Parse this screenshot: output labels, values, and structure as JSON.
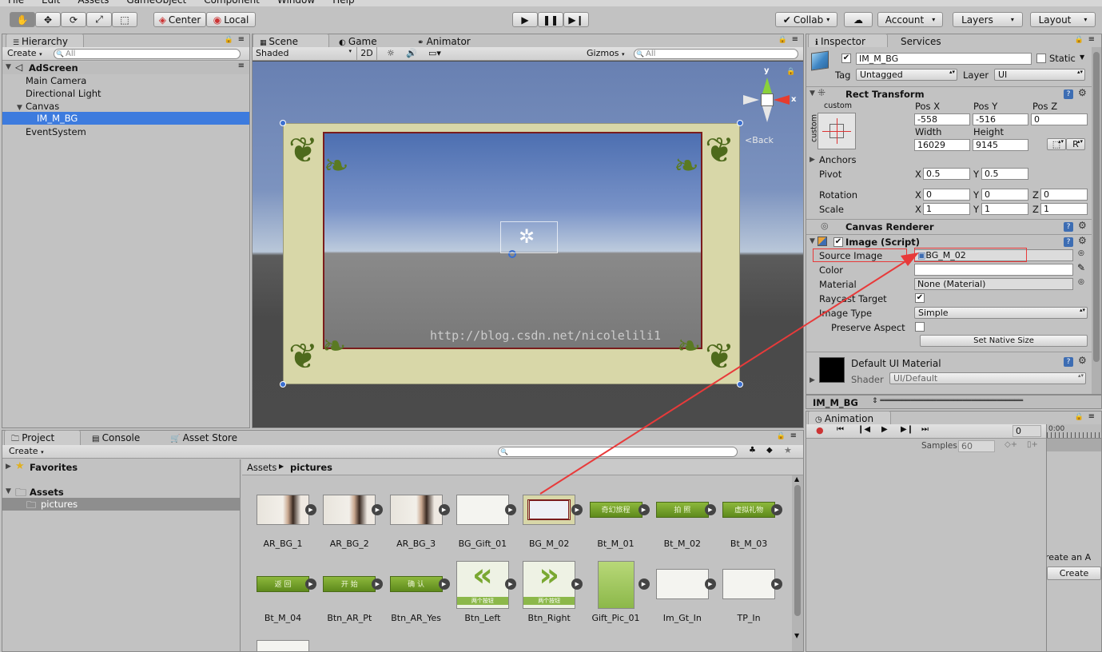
{
  "menubar": {
    "items": [
      "File",
      "Edit",
      "Assets",
      "GameObject",
      "Component",
      "Window",
      "Help"
    ]
  },
  "toolbar": {
    "tools": [
      "hand-icon",
      "move-icon",
      "rotate-icon",
      "scale-icon",
      "rect-icon"
    ],
    "pivot_center": "Center",
    "pivot_local": "Local",
    "collab": "Collab",
    "account": "Account",
    "layers": "Layers",
    "layout": "Layout"
  },
  "hierarchy": {
    "tab": "Hierarchy",
    "create": "Create",
    "search_placeholder": "All",
    "scene": "AdScreen",
    "items": [
      {
        "label": "Main Camera"
      },
      {
        "label": "Directional Light"
      },
      {
        "label": "Canvas"
      },
      {
        "label": "IM_M_BG"
      },
      {
        "label": "EventSystem"
      }
    ]
  },
  "scene_view": {
    "tabs": [
      "Scene",
      "Game",
      "Animator"
    ],
    "shading": "Shaded",
    "mode_2d": "2D",
    "gizmos": "Gizmos",
    "search_placeholder": "All",
    "back_label": "Back",
    "gizmo_y": "y",
    "gizmo_x": "x",
    "watermark": "http://blog.csdn.net/nicolelili1"
  },
  "inspector": {
    "tabs": [
      "Inspector",
      "Services"
    ],
    "object_name": "IM_M_BG",
    "static_label": "Static",
    "tag_label": "Tag",
    "tag_value": "Untagged",
    "layer_label": "Layer",
    "layer_value": "UI",
    "rect_transform": {
      "title": "Rect Transform",
      "anchor_preset": "custom",
      "anchor_side": "custom",
      "pos_x_label": "Pos X",
      "pos_x": "-558",
      "pos_y_label": "Pos Y",
      "pos_y": "-516",
      "pos_z_label": "Pos Z",
      "pos_z": "0",
      "width_label": "Width",
      "width": "16029",
      "height_label": "Height",
      "height": "9145",
      "r_button": "R",
      "anchors": "Anchors",
      "pivot": "Pivot",
      "pivot_x": "0.5",
      "pivot_y": "0.5",
      "rotation": "Rotation",
      "rot_x": "0",
      "rot_y": "0",
      "rot_z": "0",
      "scale": "Scale",
      "scale_x": "1",
      "scale_y": "1",
      "scale_z": "1",
      "x": "X",
      "y": "Y",
      "z": "Z"
    },
    "canvas_renderer": "Canvas Renderer",
    "image": {
      "title": "Image (Script)",
      "source_image_label": "Source Image",
      "source_image": "BG_M_02",
      "color_label": "Color",
      "material_label": "Material",
      "material": "None (Material)",
      "raycast_label": "Raycast Target",
      "image_type_label": "Image Type",
      "image_type": "Simple",
      "preserve_label": "Preserve Aspect",
      "native_size": "Set Native Size"
    },
    "material_preview": {
      "name": "Default UI Material",
      "shader_label": "Shader",
      "shader": "UI/Default"
    },
    "preview_bar": "IM_M_BG"
  },
  "animation": {
    "tab": "Animation",
    "frame": "0",
    "timeline": "0:00",
    "samples_label": "Samples",
    "samples": "60",
    "create_text": "reate an A",
    "create_button": "Create"
  },
  "project": {
    "tabs": [
      "Project",
      "Console",
      "Asset Store"
    ],
    "create": "Create",
    "favorites": "Favorites",
    "assets": "Assets",
    "folder": "pictures",
    "breadcrumb_root": "Assets",
    "breadcrumb_current": "pictures",
    "items": [
      {
        "name": "AR_BG_1",
        "thumb": "photo"
      },
      {
        "name": "AR_BG_2",
        "thumb": "photo"
      },
      {
        "name": "AR_BG_3",
        "thumb": "photo"
      },
      {
        "name": "BG_Gift_01",
        "thumb": "white"
      },
      {
        "name": "BG_M_02",
        "thumb": "frame"
      },
      {
        "name": "Bt_M_01",
        "thumb": "green",
        "text": "奇幻旅程"
      },
      {
        "name": "Bt_M_02",
        "thumb": "green",
        "text": "拍  照"
      },
      {
        "name": "Bt_M_03",
        "thumb": "green",
        "text": "虚拟礼物"
      },
      {
        "name": "Bt_M_04",
        "thumb": "green",
        "text": "返  回"
      },
      {
        "name": "Btn_AR_Pt",
        "thumb": "green",
        "text": "开 始"
      },
      {
        "name": "Btn_AR_Yes",
        "thumb": "green",
        "text": "确  认"
      },
      {
        "name": "Btn_Left",
        "thumb": "arrow-left",
        "text": "两个按钮"
      },
      {
        "name": "Btn_Right",
        "thumb": "arrow-right",
        "text": "两个按钮"
      },
      {
        "name": "Gift_Pic_01",
        "thumb": "greencard"
      },
      {
        "name": "Im_Gt_In",
        "thumb": "white"
      },
      {
        "name": "TP_In",
        "thumb": "white"
      }
    ]
  },
  "colors": {
    "selection": "#3d7bde",
    "annotation": "#e83a3a",
    "sky_top": "#6a83b6",
    "ground": "#4a4a4a"
  }
}
